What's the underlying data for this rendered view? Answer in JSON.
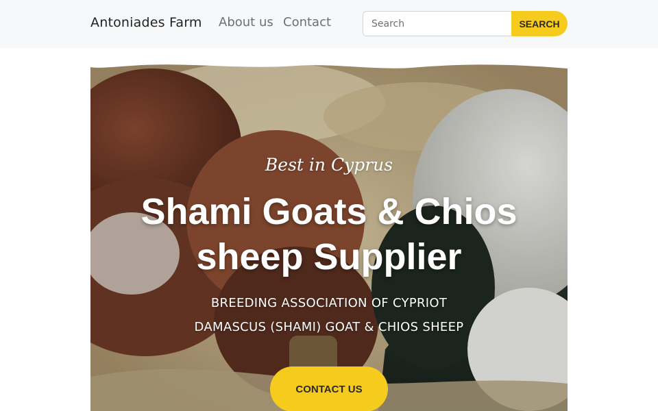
{
  "navbar": {
    "brand": "Antoniades Farm",
    "links": [
      "About us",
      "Contact"
    ],
    "search": {
      "placeholder": "Search",
      "button_label": "SEARCH"
    },
    "colors": {
      "background": "#f7f8f9",
      "accent": "#f5cb1d"
    }
  },
  "hero": {
    "tagline": "Best in Cyprus",
    "title_line1": "Shami Goats & Chios",
    "title_line2": "sheep Supplier",
    "subtitle_line1": "BREEDING ASSOCIATION OF CYPRIOT",
    "subtitle_line2": "DAMASCUS (SHAMI) GOAT & CHIOS SHEEP",
    "cta_label": "CONTACT US",
    "image": "goats-and-sheep-photo"
  }
}
